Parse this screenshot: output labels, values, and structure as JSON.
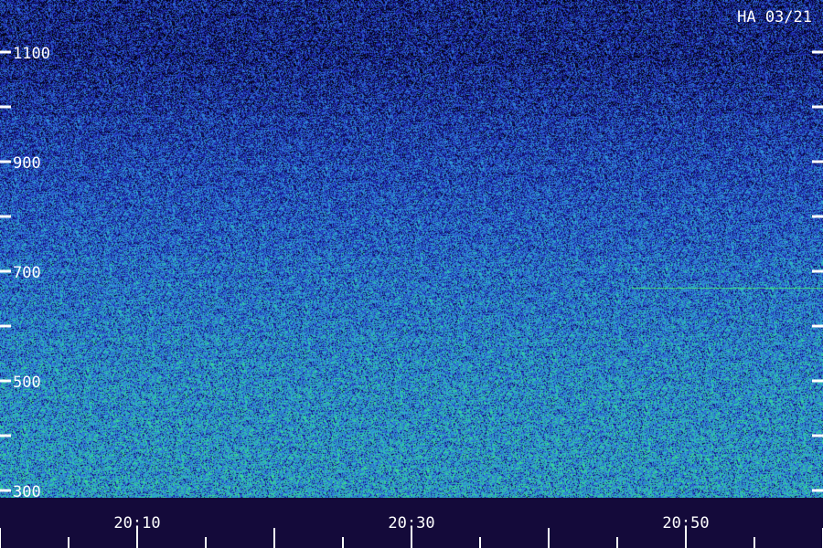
{
  "chart_data": {
    "type": "heatmap",
    "title": "HA 03/21",
    "xlabel": "",
    "ylabel": "",
    "x_ticks": [
      "20:10",
      "20:30",
      "20:50"
    ],
    "y_ticks": [
      1100,
      900,
      700,
      500,
      300
    ],
    "ylim": [
      300,
      1100
    ],
    "xlim": [
      "20:10",
      "20:50"
    ],
    "grid": false,
    "colormap": [
      "#000000",
      "#1a1aa8",
      "#2f5fd0",
      "#2fa0d8",
      "#2ed39a",
      "#5df05a"
    ],
    "intensity_profile": [
      {
        "freq": 300,
        "level": 0.62
      },
      {
        "freq": 500,
        "level": 0.58
      },
      {
        "freq": 700,
        "level": 0.48
      },
      {
        "freq": 900,
        "level": 0.36
      },
      {
        "freq": 1100,
        "level": 0.22
      }
    ],
    "features": [
      {
        "type": "persistent-line",
        "freq": 670,
        "t_start": "20:50",
        "t_end": "20:58"
      }
    ]
  },
  "colors": {
    "background": "#000000",
    "label": "#ffffff",
    "band_floor": "#140a3a"
  }
}
